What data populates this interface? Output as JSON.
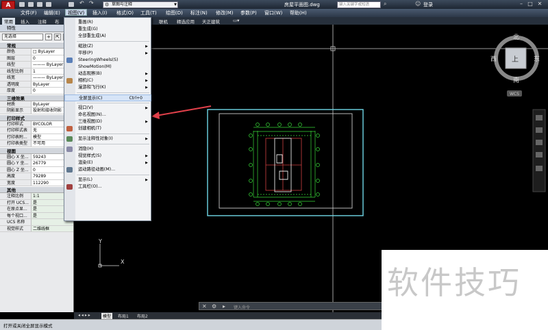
{
  "titlebar": {
    "workspace": "草图与注释",
    "doc_title": "房屋平面图.dwg",
    "search_placeholder": "键入关键字或短语",
    "login": "登录"
  },
  "menubar": [
    "文件(F)",
    "编辑(E)",
    "视图(V)",
    "插入(I)",
    "格式(O)",
    "工具(T)",
    "绘图(D)",
    "标注(N)",
    "修改(M)",
    "参数(P)",
    "窗口(W)",
    "帮助(H)"
  ],
  "ribbon": {
    "tabs_left": [
      "常用",
      "插入",
      "注释",
      "布"
    ],
    "tabs_right": [
      "联机",
      "精选应用",
      "天正建筑"
    ]
  },
  "palette": {
    "title": "特性",
    "selection": "无选择",
    "sections": [
      {
        "name": "常规",
        "rows": [
          [
            "颜色",
            "□ ByLayer"
          ],
          [
            "图层",
            "0"
          ],
          [
            "线型",
            "——— ByLayer"
          ],
          [
            "线型比例",
            "1"
          ],
          [
            "线宽",
            "——— ByLayer"
          ],
          [
            "透明度",
            "ByLayer"
          ],
          [
            "厚度",
            "0"
          ]
        ]
      },
      {
        "name": "三维效果",
        "rows": [
          [
            "材质",
            "ByLayer"
          ],
          [
            "阴影显示",
            "投射和接收阴影"
          ]
        ]
      },
      {
        "name": "打印样式",
        "rows": [
          [
            "打印样式",
            "BYCOLOR"
          ],
          [
            "打印样式表",
            "无"
          ],
          [
            "打印表附...",
            "模型"
          ],
          [
            "打印表类型",
            "不可用"
          ]
        ]
      },
      {
        "name": "视图",
        "rows": [
          [
            "圆心 X 坐...",
            "59243"
          ],
          [
            "圆心 Y 坐...",
            "26779"
          ],
          [
            "圆心 Z 坐...",
            "0"
          ],
          [
            "高度",
            "79289"
          ],
          [
            "宽度",
            "112290"
          ]
        ]
      },
      {
        "name": "其他",
        "rows": [
          [
            "注释比例",
            "1:1"
          ],
          [
            "打开 UCS...",
            "是"
          ],
          [
            "在原点显...",
            "是"
          ],
          [
            "每个视口...",
            "是"
          ],
          [
            "UCS 名称",
            ""
          ],
          [
            "视觉样式",
            "二维线框"
          ]
        ]
      }
    ]
  },
  "menu": {
    "items": [
      {
        "label": "重画(R)",
        "sub": false
      },
      {
        "label": "重生成(G)",
        "sub": false
      },
      {
        "label": "全部重生成(A)",
        "sub": false
      },
      {
        "sep": true
      },
      {
        "label": "缩放(Z)",
        "sub": true
      },
      {
        "label": "平移(P)",
        "sub": true
      },
      {
        "label": "SteeringWheels(S)",
        "sub": false
      },
      {
        "label": "ShowMotion(M)",
        "sub": false
      },
      {
        "label": "动态观察(B)",
        "sub": true
      },
      {
        "label": "相机(C)",
        "sub": true
      },
      {
        "label": "漫游和飞行(K)",
        "sub": true
      },
      {
        "sep": true
      },
      {
        "label": "全屏显示(C)",
        "shortcut": "Ctrl+0",
        "sub": false
      },
      {
        "sep": true
      },
      {
        "label": "视口(V)",
        "sub": true
      },
      {
        "label": "命名视图(N)...",
        "sub": false
      },
      {
        "label": "三维视图(D)",
        "sub": true
      },
      {
        "label": "创建相机(T)",
        "sub": false
      },
      {
        "sep": true
      },
      {
        "label": "显示注释性对象(I)",
        "sub": true
      },
      {
        "sep": true
      },
      {
        "label": "消隐(H)",
        "sub": false
      },
      {
        "label": "视觉样式(S)",
        "sub": true
      },
      {
        "label": "渲染(E)",
        "sub": true
      },
      {
        "label": "运动路径动画(M)...",
        "sub": false
      },
      {
        "sep": true
      },
      {
        "label": "显示(L)",
        "sub": true
      },
      {
        "label": "工具栏(O)...",
        "sub": false
      }
    ]
  },
  "viewcube": {
    "north": "北",
    "south": "南",
    "east": "东",
    "west": "西",
    "face": "上",
    "wcs": "WCS"
  },
  "ucs": {
    "x": "X",
    "y": "Y"
  },
  "layout_tabs": [
    "模型",
    "布局1",
    "布局2"
  ],
  "command_placeholder": "键入命令",
  "status_text": "打开或关闭全屏显示模式",
  "watermark": "软件技巧",
  "colors": {
    "accent": "#c9d6ea",
    "annotation_arrow": "#e0404a",
    "viewport_frame": "#6fd8e8",
    "grid_green": "#38d838"
  }
}
